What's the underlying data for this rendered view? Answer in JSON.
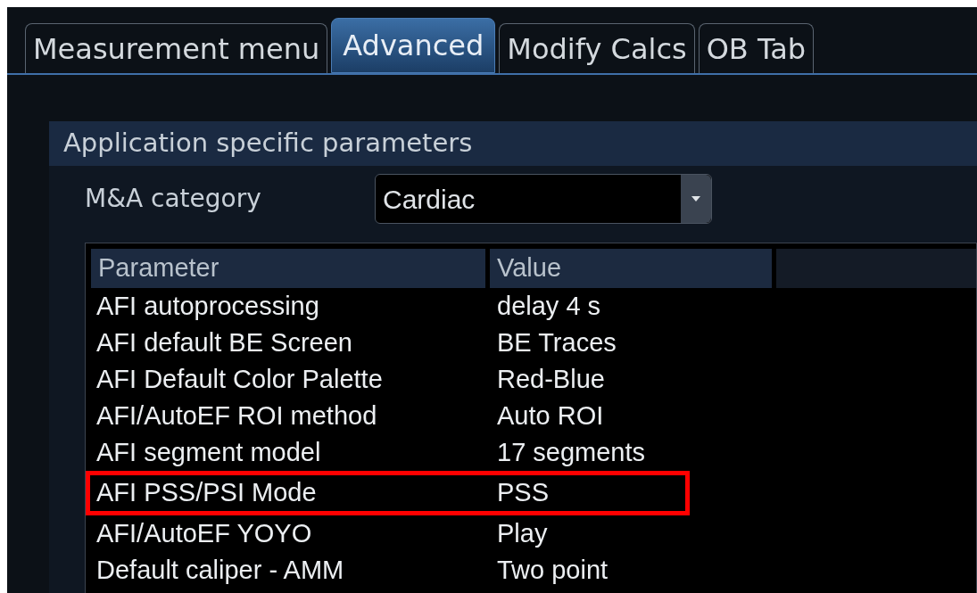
{
  "tabs": [
    {
      "label": "Measurement menu",
      "selected": false
    },
    {
      "label": "Advanced",
      "selected": true
    },
    {
      "label": "Modify Calcs",
      "selected": false
    },
    {
      "label": "OB Tab",
      "selected": false
    }
  ],
  "panel": {
    "title": "Application specific parameters",
    "category": {
      "label": "M&A category",
      "value": "Cardiac"
    },
    "table": {
      "columns": [
        "Parameter",
        "Value"
      ],
      "rows": [
        {
          "parameter": "AFI autoprocessing",
          "value": "delay 4 s",
          "highlighted": false
        },
        {
          "parameter": "AFI default BE Screen",
          "value": "BE Traces",
          "highlighted": false
        },
        {
          "parameter": "AFI Default Color Palette",
          "value": "Red-Blue",
          "highlighted": false
        },
        {
          "parameter": "AFI/AutoEF ROI method",
          "value": "Auto ROI",
          "highlighted": false
        },
        {
          "parameter": "AFI segment model",
          "value": "17 segments",
          "highlighted": false
        },
        {
          "parameter": "AFI PSS/PSI Mode",
          "value": "PSS",
          "highlighted": true
        },
        {
          "parameter": "AFI/AutoEF YOYO",
          "value": "Play",
          "highlighted": false
        },
        {
          "parameter": "Default caliper - AMM",
          "value": "Two point",
          "highlighted": false
        }
      ]
    }
  }
}
